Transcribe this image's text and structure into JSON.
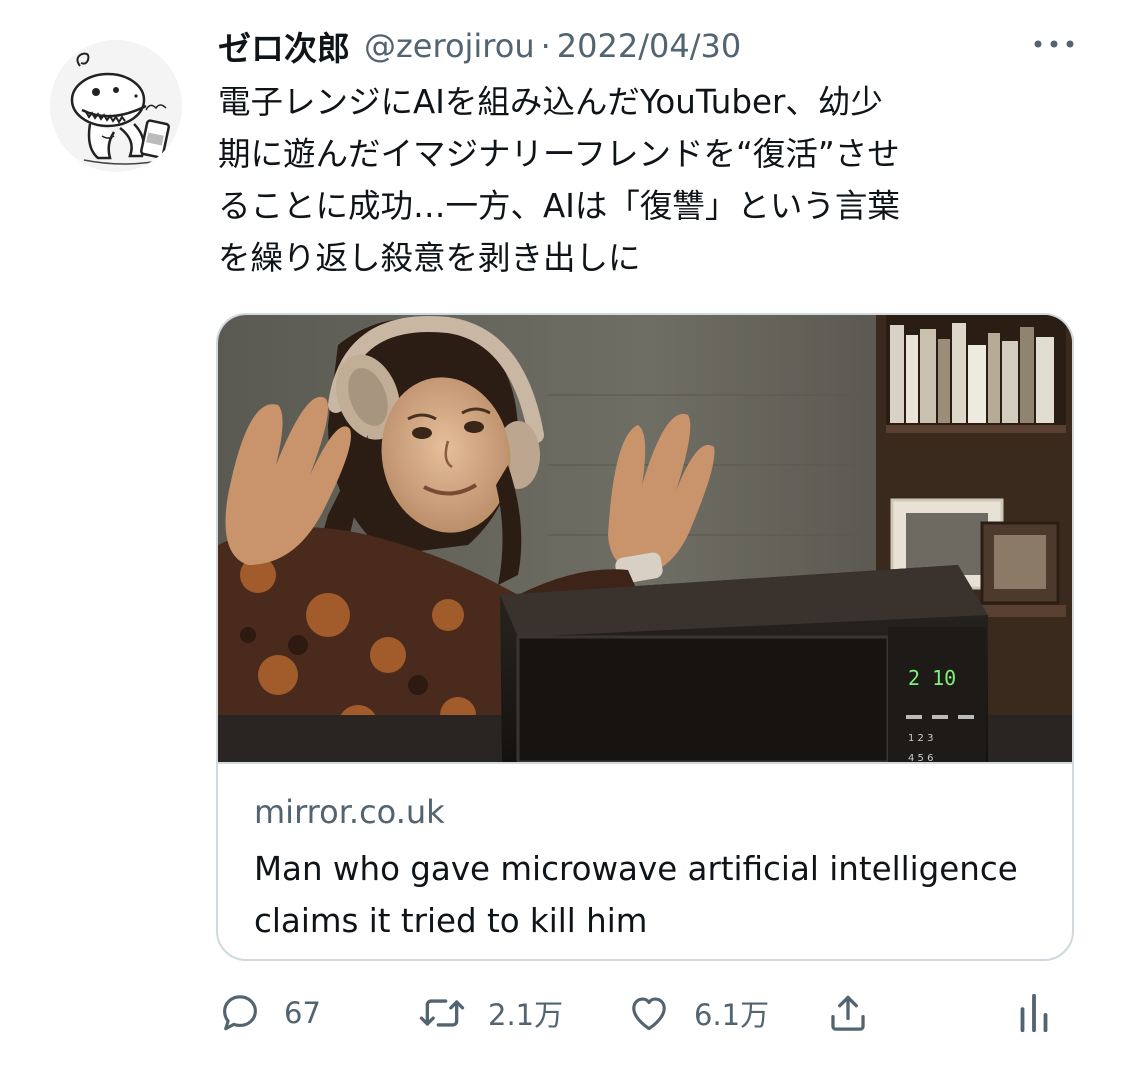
{
  "tweet": {
    "display_name": "ゼロ次郎",
    "handle": "@zerojirou",
    "separator": "·",
    "date": "2022/04/30",
    "text": "電子レンジにAIを組み込んだYouTuber、幼少\n期に遊んだイマジナリーフレンドを“復活”させ\nることに成功…一方、AIは「復讐」という言葉\nを繰り返し殺意を剥き出しに"
  },
  "card": {
    "domain": "mirror.co.uk",
    "title": "Man who gave microwave artificial intelligence claims it tried to kill him",
    "microwave_display": "2 10",
    "keypad_row1": "1  2  3",
    "keypad_row2": "4  5  6"
  },
  "actions": {
    "reply_count": "67",
    "retweet_count": "2.1万",
    "like_count": "6.1万"
  },
  "icons": {
    "reply": "reply-icon",
    "retweet": "retweet-icon",
    "like": "heart-icon",
    "share": "share-icon",
    "analytics": "analytics-icon",
    "more": "more-dots-icon"
  },
  "colors": {
    "text_primary": "#0f1419",
    "text_secondary": "#536471",
    "border": "#cfd9de"
  }
}
